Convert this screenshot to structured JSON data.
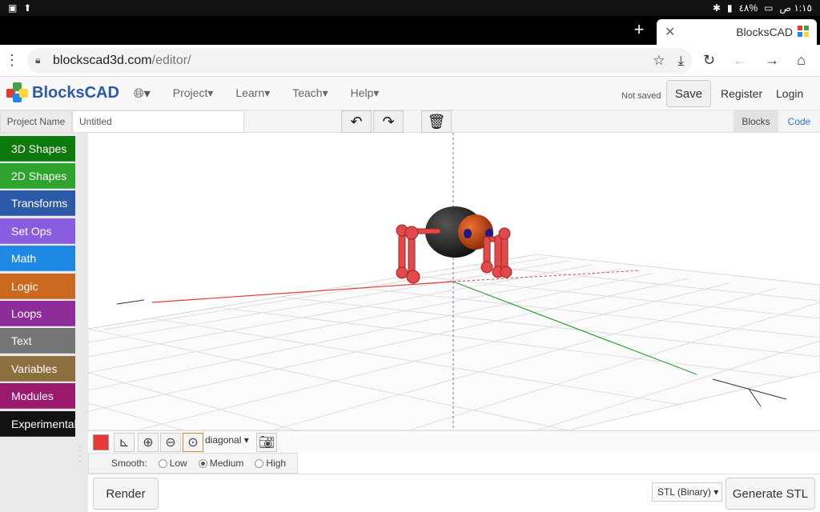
{
  "status_bar": {
    "time": "١:١٥ ص",
    "battery": "٤٨%"
  },
  "browser": {
    "tab_title": "BlocksCAD",
    "url_host": "blockscad3d.com",
    "url_path": "/editor/"
  },
  "app": {
    "logo_text": "BlocksCAD",
    "menu": [
      "Project",
      "Learn",
      "Teach",
      "Help"
    ],
    "save_status": "Not saved",
    "save_label": "Save",
    "register_label": "Register",
    "login_label": "Login"
  },
  "toolbar": {
    "project_name_label": "Project Name",
    "project_name_value": "Untitled",
    "blocks_tab": "Blocks",
    "code_tab": "Code"
  },
  "categories": [
    {
      "label": "3D Shapes",
      "color": "#0e7a0d"
    },
    {
      "label": "2D Shapes",
      "color": "#2ea32e"
    },
    {
      "label": "Transforms",
      "color": "#2d5aa8"
    },
    {
      "label": "Set Ops",
      "color": "#8a5ce0"
    },
    {
      "label": "Math",
      "color": "#1e88e5"
    },
    {
      "label": "Logic",
      "color": "#c8691f"
    },
    {
      "label": "Loops",
      "color": "#8e2c9a"
    },
    {
      "label": "Text",
      "color": "#757575"
    },
    {
      "label": "Variables",
      "color": "#8d6e3f"
    },
    {
      "label": "Modules",
      "color": "#9c1a6e"
    },
    {
      "label": "Experimental",
      "color": "#111111"
    }
  ],
  "viewer": {
    "view_mode": "diagonal",
    "smooth_label": "Smooth:",
    "smooth_options": [
      "Low",
      "Medium",
      "High"
    ],
    "smooth_selected": "Medium",
    "model_color": "#e53935"
  },
  "actions": {
    "render_label": "Render",
    "stl_format": "STL (Binary)",
    "generate_label": "Generate STL"
  }
}
